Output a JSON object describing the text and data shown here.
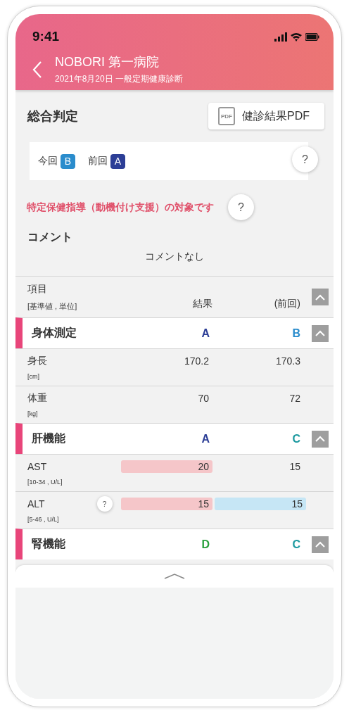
{
  "status_bar": {
    "time": "9:41"
  },
  "header": {
    "title": "NOBORI 第一病院",
    "subtitle": "2021年8月20日 一般定期健康診断"
  },
  "overall": {
    "title": "総合判定",
    "pdf_button": {
      "icon_text": "PDF",
      "label": "健診結果PDF"
    },
    "grades": [
      {
        "label": "今回",
        "grade": "B",
        "color": "#2a8ccc"
      },
      {
        "label": "前回",
        "grade": "A",
        "color": "#2c3e96"
      }
    ],
    "help": "?"
  },
  "guidance": {
    "text": "特定保健指導（動機付け支援）の対象です",
    "help": "?"
  },
  "comment": {
    "title": "コメント",
    "text": "コメントなし"
  },
  "table": {
    "columns": {
      "item": "項目",
      "unit": "[基準値 , 単位]",
      "result": "結果",
      "previous": "(前回)"
    },
    "expanded": true,
    "sections": [
      {
        "name": "身体測定",
        "expanded": true,
        "result": {
          "text": "A",
          "color": "#2c3e96"
        },
        "previous": {
          "text": "B",
          "color": "#2a8ccc"
        },
        "items": [
          {
            "name": "身長",
            "range": "[cm]",
            "result": {
              "text": "170.2"
            },
            "previous": {
              "text": "170.3"
            }
          },
          {
            "name": "体重",
            "range": "[kg]",
            "result": {
              "text": "70"
            },
            "previous": {
              "text": "72"
            }
          }
        ]
      },
      {
        "name": "肝機能",
        "expanded": true,
        "result": {
          "text": "A",
          "color": "#2c3e96"
        },
        "previous": {
          "text": "C",
          "color": "#1e9aa0"
        },
        "items": [
          {
            "name": "AST",
            "range": "[10-34 , U/L]",
            "result": {
              "text": "20",
              "color": "#f5c6c9"
            },
            "previous": {
              "text": "15"
            }
          },
          {
            "name": "ALT",
            "range": "[5-46 , U/L]",
            "help": "?",
            "result": {
              "text": "15",
              "color": "#f5c6c9"
            },
            "previous": {
              "text": "15",
              "color": "#c6e6f5"
            }
          }
        ]
      },
      {
        "name": "腎機能",
        "expanded": true,
        "result": {
          "text": "D",
          "color": "#28a03c"
        },
        "previous": {
          "text": "C",
          "color": "#1e9aa0"
        }
      }
    ]
  }
}
